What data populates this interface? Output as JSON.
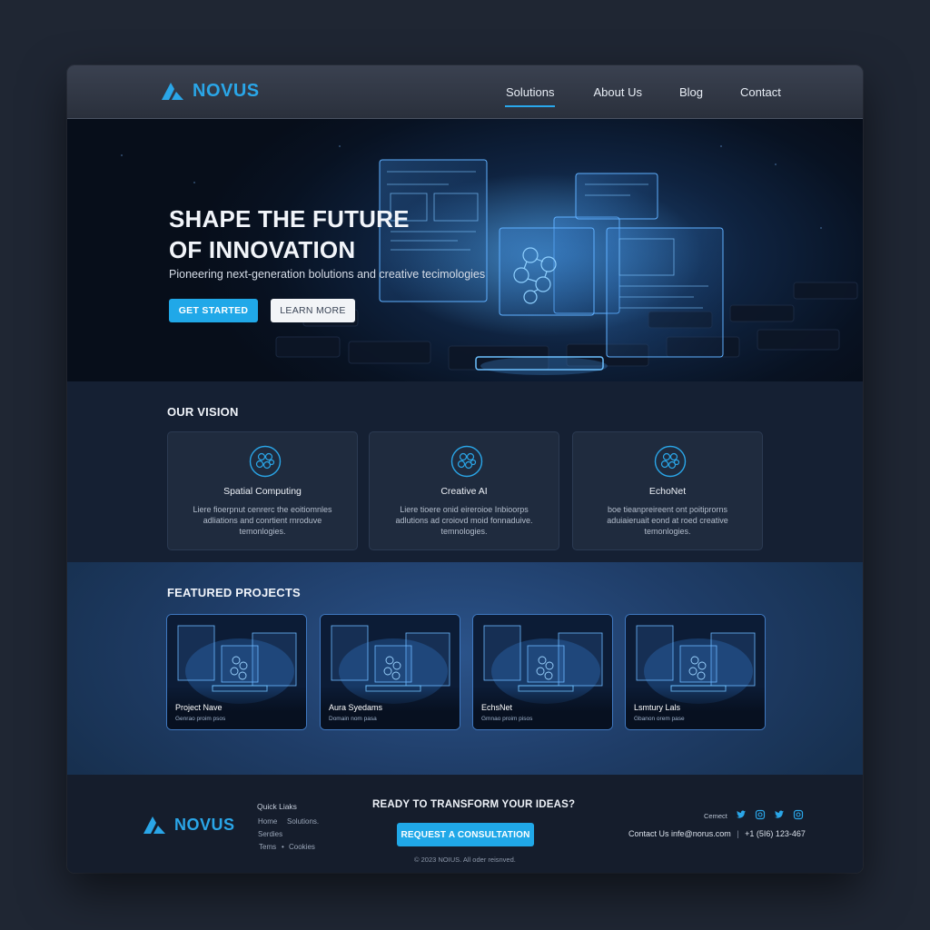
{
  "brand": {
    "name": "NOVUS",
    "color": "#2aa6e8"
  },
  "nav": {
    "items": [
      {
        "label": "Solutions",
        "active": true
      },
      {
        "label": "About Us",
        "active": false
      },
      {
        "label": "Blog",
        "active": false
      },
      {
        "label": "Contact",
        "active": false
      }
    ]
  },
  "hero": {
    "title_line1": "SHAPE THE FUTURE",
    "title_line2": "OF INNOVATION",
    "subtitle": "Pioneering next-generation bolutions and creative tecimologies",
    "primary_button": "GET STARTED",
    "secondary_button": "LEARN MORE"
  },
  "vision": {
    "title": "OUR VISION",
    "cards": [
      {
        "icon": "network-icon",
        "title": "Spatial Computing",
        "desc_line1": "Liere fioerpnut cenrerc the eoitiomnles",
        "desc_line2": "adliations and conrtient rnroduve",
        "desc_line3": "temonlogies."
      },
      {
        "icon": "network-icon",
        "title": "Creative AI",
        "desc_line1": "Liere tioere onid eireroioe Inbioorps",
        "desc_line2": "adlutions ad croiovd moid fonnaduive.",
        "desc_line3": "temnologies."
      },
      {
        "icon": "network-icon",
        "title": "EchoNet",
        "desc_line1": "boe tieanpreireent ont poitiprorns",
        "desc_line2": "aduiaieruait eond at roed creative",
        "desc_line3": "temonlogies."
      }
    ]
  },
  "projects": {
    "title": "FEATURED PROJECTS",
    "items": [
      {
        "title": "Project Nave",
        "subtitle": "Genrao proim psos"
      },
      {
        "title": "Aura Syedams",
        "subtitle": "Domain nom pasa"
      },
      {
        "title": "EchsNet",
        "subtitle": "Gmnao proim pisos"
      },
      {
        "title": "Lsmtury Lals",
        "subtitle": "Gbanon orem pase"
      }
    ]
  },
  "footer": {
    "quick_links_title": "Quick Liaks",
    "links": {
      "home": "Home",
      "solutions": "Solutions.",
      "services": "Serdies",
      "terms": "Tems",
      "cookies": "Cookies",
      "bullet": "•"
    },
    "cta_title": "READY TO TRANSFORM YOUR IDEAS?",
    "cta_button": "REQUEST A CONSULTATION",
    "copyright": "© 2023 NOIUS. All oder reisnved.",
    "connect_label": "Cemect",
    "social_icons": [
      "twitter-icon",
      "instagram-icon",
      "twitter-icon",
      "instagram-icon"
    ],
    "contact_label": "Contact Us",
    "email": "infe@norus.com",
    "separator": "|",
    "phone": "+1 (5I6) 123-467"
  },
  "colors": {
    "accent": "#20a8e8",
    "page_bg": "#1f2633",
    "nav_bg": "#2f3542",
    "card_bg": "#1f2b3e",
    "projects_bg": "#1f3d68",
    "footer_bg": "#151d2c"
  }
}
